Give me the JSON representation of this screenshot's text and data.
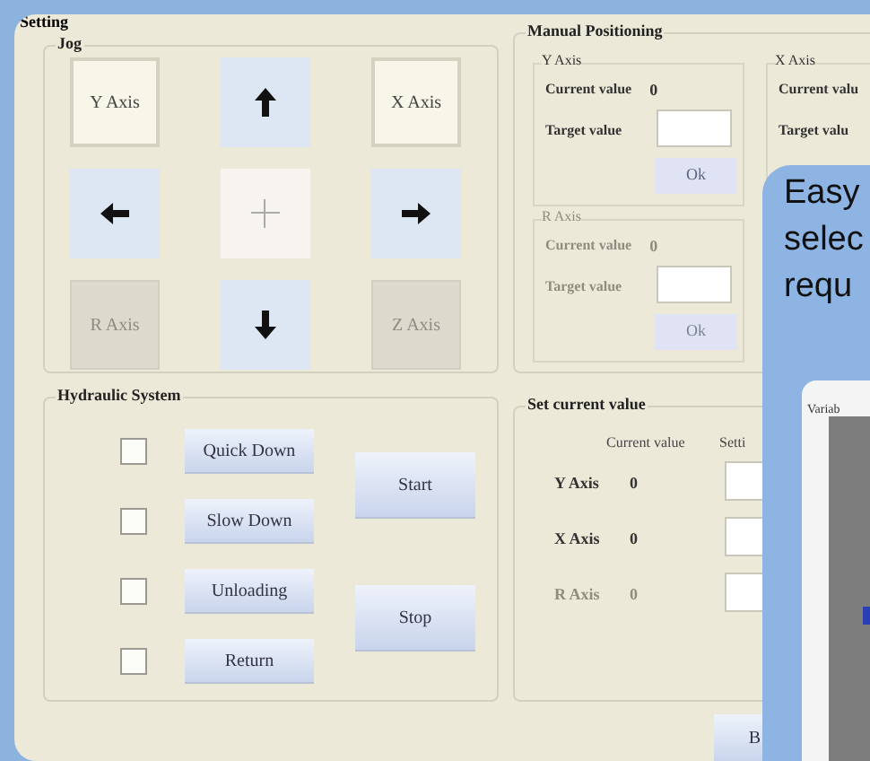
{
  "window": {
    "title": "Setting"
  },
  "jog": {
    "title": "Jog",
    "buttons": [
      {
        "kind": "text",
        "label": "Y Axis",
        "disabled": false
      },
      {
        "kind": "up",
        "disabled": false
      },
      {
        "kind": "text",
        "label": "X Axis",
        "disabled": false
      },
      {
        "kind": "left",
        "disabled": false
      },
      {
        "kind": "plus",
        "disabled": false
      },
      {
        "kind": "right",
        "disabled": false
      },
      {
        "kind": "text",
        "label": "R Axis",
        "disabled": true
      },
      {
        "kind": "down",
        "disabled": false
      },
      {
        "kind": "text",
        "label": "Z Axis",
        "disabled": true
      }
    ]
  },
  "manual_positioning": {
    "title": "Manual Positioning",
    "groups": [
      {
        "title": "Y Axis",
        "current_label": "Current value",
        "current_value": "0",
        "target_label": "Target value",
        "button": "Ok",
        "disabled": false
      },
      {
        "title": "R Axis",
        "current_label": "Current value",
        "current_value": "0",
        "target_label": "Target value",
        "button": "Ok",
        "disabled": true
      },
      {
        "title": "X Axis",
        "current_label": "Current valu",
        "target_label": "Target valu",
        "disabled": false
      }
    ]
  },
  "hydraulic_system": {
    "title": "Hydraulic System",
    "items": [
      {
        "label": "Quick Down",
        "checked": false
      },
      {
        "label": "Slow Down",
        "checked": false
      },
      {
        "label": "Unloading",
        "checked": false
      },
      {
        "label": "Return",
        "checked": false
      }
    ],
    "buttons": [
      "Start",
      "Stop"
    ]
  },
  "set_current_value": {
    "title": "Set current value",
    "columns": [
      "Current value",
      "Setti"
    ],
    "rows": [
      {
        "axis": "Y Axis",
        "value": "0",
        "disabled": false
      },
      {
        "axis": "X Axis",
        "value": "0",
        "disabled": false
      },
      {
        "axis": "R Axis",
        "value": "0",
        "disabled": true
      }
    ]
  },
  "bottom_button": "B",
  "callout": {
    "lines": [
      "Easy",
      "selec",
      "requ"
    ],
    "window_title": "Variab"
  }
}
